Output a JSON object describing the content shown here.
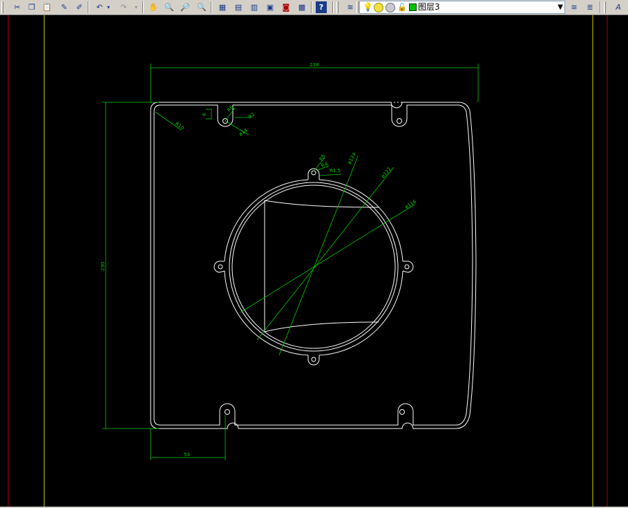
{
  "toolbar": {
    "layer_name": "图层3",
    "buttons": [
      "scissors-icon",
      "copy-icon",
      "paste-icon",
      "brush-icon",
      "match-properties-icon",
      "undo-icon",
      "redo-icon",
      "pan-icon",
      "zoom-realtime-icon",
      "zoom-window-icon",
      "zoom-previous-icon",
      "properties-icon",
      "design-center-icon",
      "tool-palette-icon",
      "sheet-set-icon",
      "markup-icon",
      "calculator-icon",
      "help-icon"
    ]
  },
  "drawing": {
    "dimensions": {
      "width_overall": "238",
      "height_overall": "230",
      "bottom_offset": "53",
      "corner_radius": "R10",
      "top_hole_label_a": "6",
      "top_hole_label_b": "R6",
      "top_hole_label_c": "R2",
      "top_hole_diameter": "ø14",
      "ring_hole_a": "R6",
      "ring_hole_b": "R4",
      "ring_hole_c": "R1.5",
      "circle_d1": "ø124",
      "circle_d2": "ø122",
      "circle_d3": "ø116"
    }
  },
  "colors": {
    "background": "#000000",
    "geometry": "#ffffff",
    "dimension": "#00d000",
    "border_yellow": "#d8d800",
    "border_red": "#c00000",
    "toolbar": "#d4d0c8"
  }
}
